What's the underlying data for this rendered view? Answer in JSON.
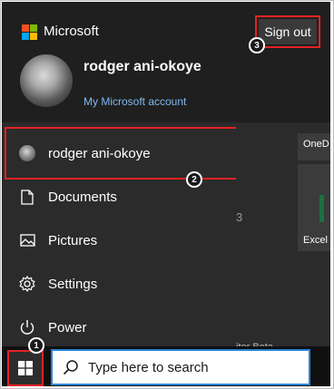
{
  "flyout": {
    "brand": "Microsoft",
    "sign_out_label": "Sign out",
    "user_name": "rodger ani-okoye",
    "account_link": "My Microsoft account"
  },
  "menu": {
    "items": [
      {
        "label": "rodger ani-okoye",
        "icon": "user-avatar"
      },
      {
        "label": "Documents",
        "icon": "document-icon"
      },
      {
        "label": "Pictures",
        "icon": "picture-icon"
      },
      {
        "label": "Settings",
        "icon": "gear-icon"
      },
      {
        "label": "Power",
        "icon": "power-icon"
      }
    ]
  },
  "tiles": {
    "tile1_label": "OneD",
    "tile2_label": "Excel",
    "peek_text": "3",
    "peek_text_2": "itor Beta"
  },
  "taskbar": {
    "search_placeholder": "Type here to search"
  },
  "badges": {
    "one": "1",
    "two": "2",
    "three": "3"
  },
  "colors": {
    "highlight": "#e52224",
    "link": "#7fb9f0",
    "search_border": "#2a84d6"
  }
}
